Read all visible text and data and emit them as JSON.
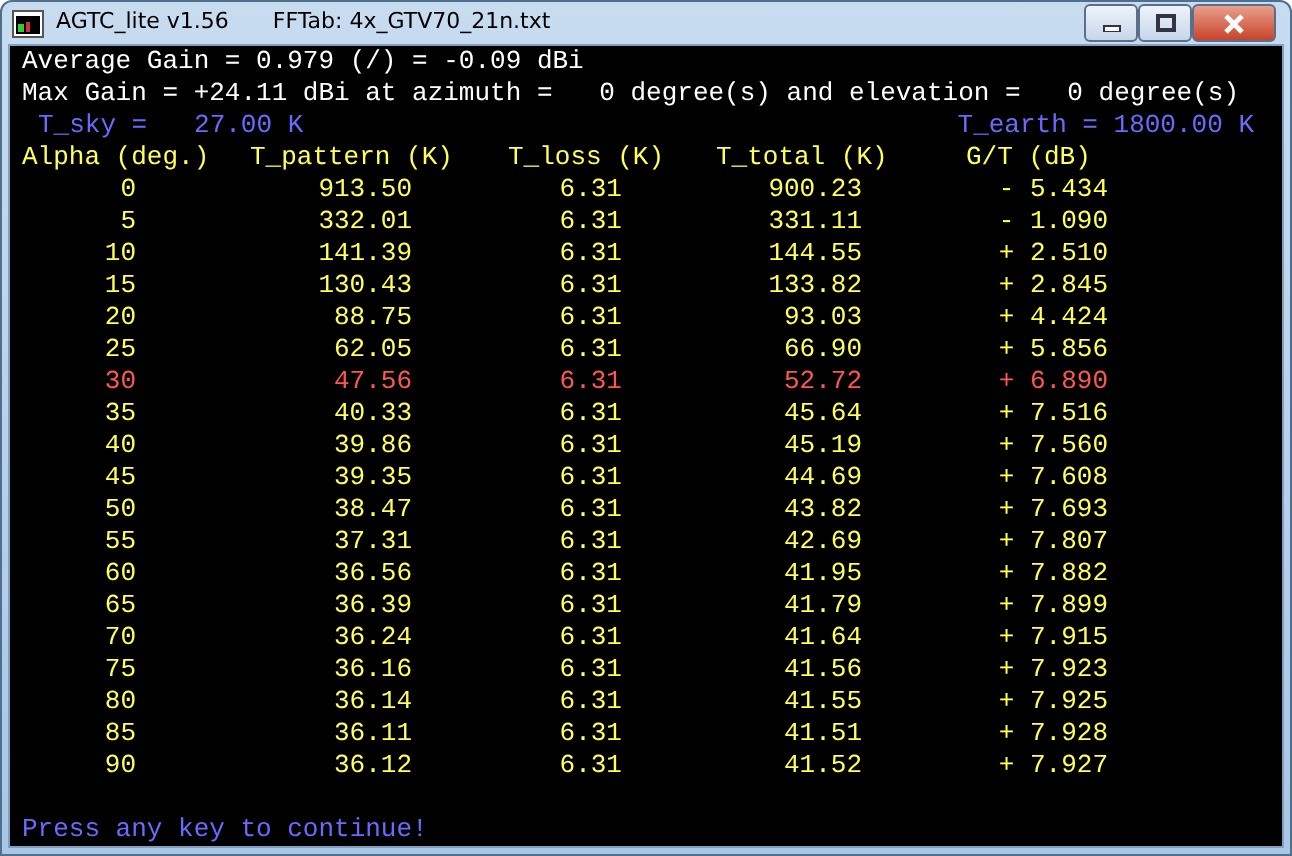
{
  "window": {
    "title": "AGTC_lite v1.56",
    "subtitle": "FFTab: 4x_GTV70_21n.txt"
  },
  "info_lines": [
    "Average Gain = 0.979 (/) = -0.09 dBi",
    "Max Gain = +24.11 dBi at azimuth =   0 degree(s) and elevation =   0 degree(s)"
  ],
  "t_sky": "T_sky =   27.00 K",
  "t_earth": "T_earth = 1800.00 K",
  "columns": [
    "Alpha (deg.)",
    "T_pattern (K)",
    "T_loss (K)",
    "T_total (K)",
    "G/T (dB)"
  ],
  "rows": [
    {
      "cells": [
        "0",
        "913.50",
        "6.31",
        "900.23",
        "- 5.434"
      ],
      "highlighted": false
    },
    {
      "cells": [
        "5",
        "332.01",
        "6.31",
        "331.11",
        "- 1.090"
      ],
      "highlighted": false
    },
    {
      "cells": [
        "10",
        "141.39",
        "6.31",
        "144.55",
        "+ 2.510"
      ],
      "highlighted": false
    },
    {
      "cells": [
        "15",
        "130.43",
        "6.31",
        "133.82",
        "+ 2.845"
      ],
      "highlighted": false
    },
    {
      "cells": [
        "20",
        "88.75",
        "6.31",
        "93.03",
        "+ 4.424"
      ],
      "highlighted": false
    },
    {
      "cells": [
        "25",
        "62.05",
        "6.31",
        "66.90",
        "+ 5.856"
      ],
      "highlighted": false
    },
    {
      "cells": [
        "30",
        "47.56",
        "6.31",
        "52.72",
        "+ 6.890"
      ],
      "highlighted": true
    },
    {
      "cells": [
        "35",
        "40.33",
        "6.31",
        "45.64",
        "+ 7.516"
      ],
      "highlighted": false
    },
    {
      "cells": [
        "40",
        "39.86",
        "6.31",
        "45.19",
        "+ 7.560"
      ],
      "highlighted": false
    },
    {
      "cells": [
        "45",
        "39.35",
        "6.31",
        "44.69",
        "+ 7.608"
      ],
      "highlighted": false
    },
    {
      "cells": [
        "50",
        "38.47",
        "6.31",
        "43.82",
        "+ 7.693"
      ],
      "highlighted": false
    },
    {
      "cells": [
        "55",
        "37.31",
        "6.31",
        "42.69",
        "+ 7.807"
      ],
      "highlighted": false
    },
    {
      "cells": [
        "60",
        "36.56",
        "6.31",
        "41.95",
        "+ 7.882"
      ],
      "highlighted": false
    },
    {
      "cells": [
        "65",
        "36.39",
        "6.31",
        "41.79",
        "+ 7.899"
      ],
      "highlighted": false
    },
    {
      "cells": [
        "70",
        "36.24",
        "6.31",
        "41.64",
        "+ 7.915"
      ],
      "highlighted": false
    },
    {
      "cells": [
        "75",
        "36.16",
        "6.31",
        "41.56",
        "+ 7.923"
      ],
      "highlighted": false
    },
    {
      "cells": [
        "80",
        "36.14",
        "6.31",
        "41.55",
        "+ 7.925"
      ],
      "highlighted": false
    },
    {
      "cells": [
        "85",
        "36.11",
        "6.31",
        "41.51",
        "+ 7.928"
      ],
      "highlighted": false
    },
    {
      "cells": [
        "90",
        "36.12",
        "6.31",
        "41.52",
        "+ 7.927"
      ],
      "highlighted": false
    }
  ],
  "prompt": "Press any key to continue!"
}
